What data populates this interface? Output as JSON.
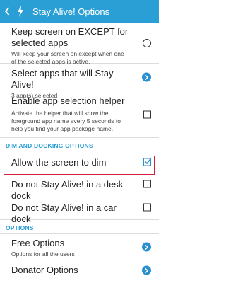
{
  "appbar": {
    "title": "Stay Alive! Options",
    "back_icon": "chevron-left-icon",
    "app_icon": "lightning-bolt-icon"
  },
  "items": {
    "keep_screen": {
      "title": "Keep screen on EXCEPT for selected apps",
      "summary": "Will keep your screen on except when one of the selected apps is active."
    },
    "select_apps": {
      "title": "Select apps that will Stay Alive!",
      "summary": "3 app(s) selected"
    },
    "helper": {
      "title": "Enable app selection helper",
      "summary": "Activate the helper that will show the foreground app name every 5 seconds to help you find your app package name."
    },
    "dim_section": "DIM AND DOCKING OPTIONS",
    "allow_dim": {
      "title": "Allow the screen to dim",
      "checked": true
    },
    "desk_dock": {
      "title": "Do not Stay Alive! in a desk dock",
      "checked": false
    },
    "car_dock": {
      "title": "Do not Stay Alive! in a car dock",
      "checked": false
    },
    "options_section": "OPTIONS",
    "free_options": {
      "title": "Free Options",
      "summary": "Options for all the users"
    },
    "donator_options": {
      "title": "Donator Options"
    }
  },
  "colors": {
    "accent": "#2a9fd6",
    "highlight": "#d4203a"
  }
}
